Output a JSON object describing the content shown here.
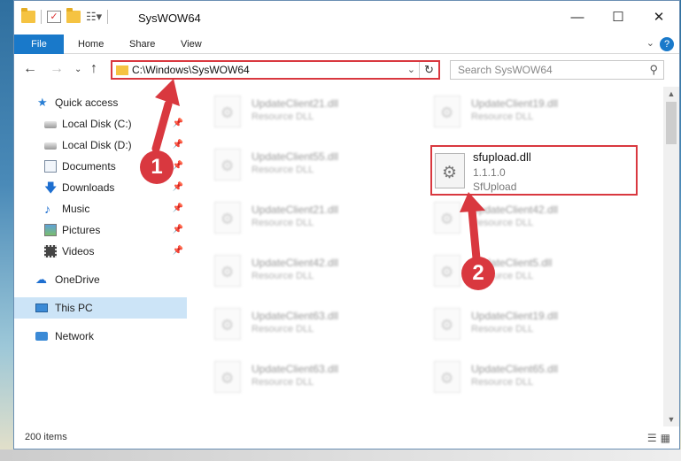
{
  "window": {
    "title": "SysWOW64",
    "controls": {
      "minimize": "—",
      "maximize": "☐",
      "close": "✕"
    }
  },
  "ribbon": {
    "tabs": [
      "File",
      "Home",
      "Share",
      "View"
    ],
    "help": "?",
    "expand": "⌄"
  },
  "address": {
    "path": "C:\\Windows\\SysWOW64",
    "dropdown": "⌄",
    "refresh": "↻"
  },
  "nav_buttons": {
    "back": "←",
    "forward": "→",
    "recent": "⌄",
    "up": "↑"
  },
  "search": {
    "placeholder": "Search SysWOW64",
    "icon": "search-icon"
  },
  "sidebar": {
    "items": [
      {
        "label": "Quick access",
        "icon": "star-icon"
      },
      {
        "label": "Local Disk (C:)",
        "icon": "disk-icon",
        "pinned": true
      },
      {
        "label": "Local Disk (D:)",
        "icon": "disk-icon",
        "pinned": true
      },
      {
        "label": "Documents",
        "icon": "documents-icon",
        "pinned": true
      },
      {
        "label": "Downloads",
        "icon": "downloads-icon",
        "pinned": true
      },
      {
        "label": "Music",
        "icon": "music-icon",
        "pinned": true
      },
      {
        "label": "Pictures",
        "icon": "pictures-icon",
        "pinned": true
      },
      {
        "label": "Videos",
        "icon": "videos-icon",
        "pinned": true
      },
      {
        "label": "OneDrive",
        "icon": "onedrive-icon"
      },
      {
        "label": "This PC",
        "icon": "pc-icon",
        "selected": true
      },
      {
        "label": "Network",
        "icon": "network-icon"
      }
    ]
  },
  "files": [
    {
      "name": "UpdateClient21.dll",
      "type": "Resource DLL"
    },
    {
      "name": "UpdateClient19.dll",
      "type": "Resource DLL"
    },
    {
      "name": "UpdateClient55.dll",
      "type": "Resource DLL"
    },
    {
      "name": "UpdateClient21.dll",
      "type": "Resource DLL"
    },
    {
      "name": "UpdateClient42.dll",
      "type": "Resource DLL"
    },
    {
      "name": "UpdateClient42.dll",
      "type": "Resource DLL"
    },
    {
      "name": "UpdateClient5.dll",
      "type": "Resource DLL"
    },
    {
      "name": "UpdateClient63.dll",
      "type": "Resource DLL"
    },
    {
      "name": "UpdateClient19.dll",
      "type": "Resource DLL"
    },
    {
      "name": "UpdateClient63.dll",
      "type": "Resource DLL"
    },
    {
      "name": "UpdateClient65.dll",
      "type": "Resource DLL"
    }
  ],
  "highlighted_file": {
    "name": "sfupload.dll",
    "version": "1.1.1.0",
    "description": "SfUpload"
  },
  "annotations": {
    "step1": "1",
    "step2": "2",
    "color": "#d9383f"
  },
  "status": {
    "item_count": "200 items"
  }
}
